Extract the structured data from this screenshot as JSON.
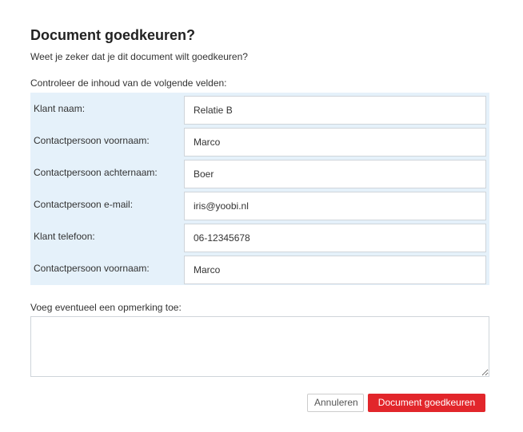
{
  "dialog": {
    "title": "Document goedkeuren?",
    "subtitle": "Weet je zeker dat je dit document wilt goedkeuren?",
    "fields_label": "Controleer de inhoud van de volgende velden:",
    "fields": [
      {
        "label": "Klant naam:",
        "value": "Relatie B"
      },
      {
        "label": "Contactpersoon voornaam:",
        "value": "Marco"
      },
      {
        "label": "Contactpersoon achternaam:",
        "value": "Boer"
      },
      {
        "label": "Contactpersoon e-mail:",
        "value": "iris@yoobi.nl"
      },
      {
        "label": "Klant telefoon:",
        "value": "06-12345678"
      },
      {
        "label": "Contactpersoon voornaam:",
        "value": "Marco"
      }
    ],
    "remark_label": "Voeg eventueel een opmerking toe:",
    "remark_value": "",
    "cancel_label": "Annuleren",
    "approve_label": "Document goedkeuren"
  },
  "colors": {
    "table_bg": "#e5f1fa",
    "approve_button": "#e2262b",
    "input_border": "#cfd5da"
  }
}
